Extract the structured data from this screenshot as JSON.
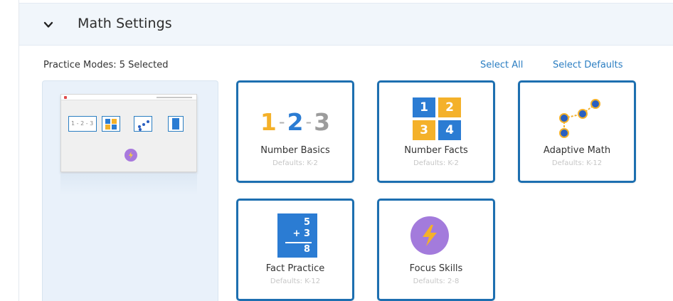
{
  "header": {
    "title": "Math Settings",
    "toggle_icon": "chevron-down-icon"
  },
  "modes": {
    "label": "Practice Modes: 5 Selected",
    "select_all": "Select All",
    "select_defaults": "Select Defaults"
  },
  "preview": {
    "mini_numbers": "1 - 2 - 3",
    "mini_grid": [
      "1",
      "2",
      "3",
      "4"
    ],
    "mini_fact": "5\n+3\n8"
  },
  "cards": [
    {
      "name": "Number Basics",
      "defaults": "Defaults: K-2",
      "art": {
        "digits": [
          "1",
          "2",
          "3"
        ],
        "separator": "-"
      },
      "icon": "number-sequence-icon"
    },
    {
      "name": "Number Facts",
      "defaults": "Defaults: K-2",
      "art": {
        "cells": [
          "1",
          "2",
          "3",
          "4"
        ],
        "colors": [
          "#2b7cd3",
          "#f4b12a",
          "#f4b12a",
          "#2b7cd3"
        ]
      },
      "icon": "number-grid-icon"
    },
    {
      "name": "Adaptive Math",
      "defaults": "Defaults: K-12",
      "icon": "connected-dots-icon"
    },
    {
      "name": "Fact Practice",
      "defaults": "Defaults: K-12",
      "art": {
        "top": "5",
        "bottom": "+ 3",
        "result": "8"
      },
      "icon": "addition-card-icon"
    },
    {
      "name": "Focus Skills",
      "defaults": "Defaults: 2-8",
      "icon": "lightning-bolt-icon"
    }
  ],
  "colors": {
    "card_border": "#1d6fb0",
    "link": "#2b7ec2",
    "header_bg": "#f1f6fb",
    "preview_bg": "#e9f1fa",
    "purple": "#a37bdc",
    "yellow": "#f4b12a",
    "blue": "#2b7cd3"
  }
}
